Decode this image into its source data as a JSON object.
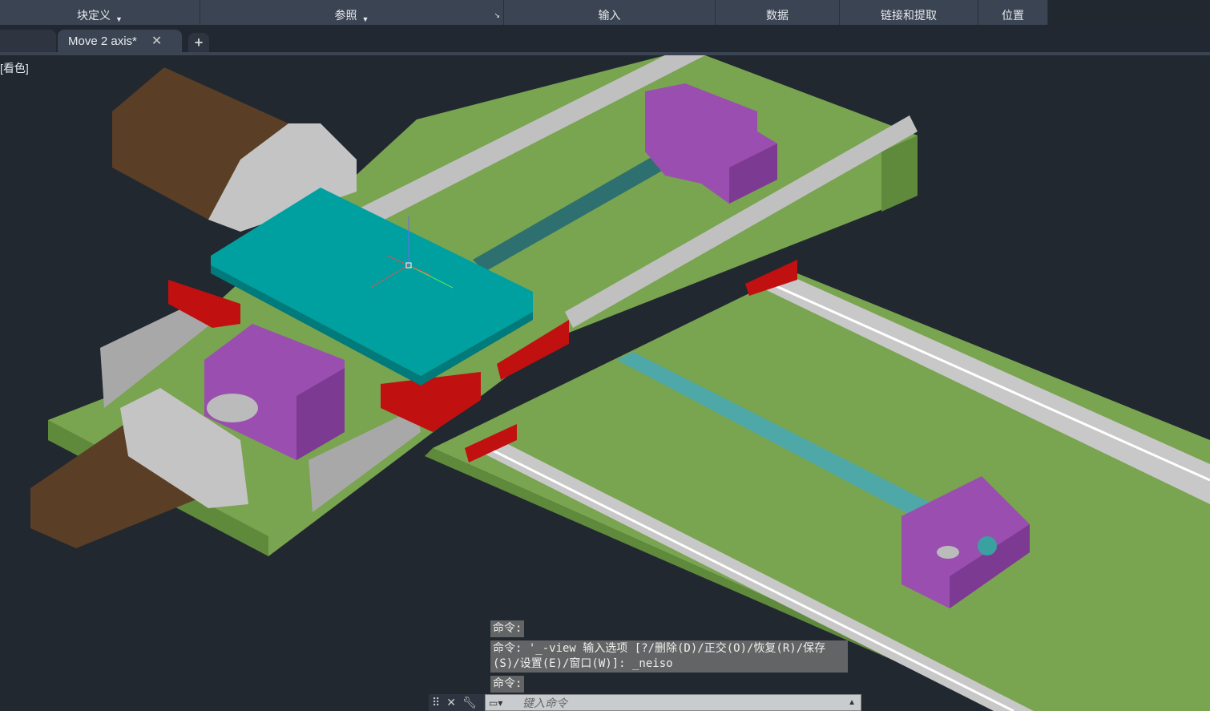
{
  "ribbon": {
    "panels": [
      {
        "label": "块定义",
        "dropdown": true
      },
      {
        "label": "参照",
        "dropdown": true
      },
      {
        "label": "输入"
      },
      {
        "label": "数据"
      },
      {
        "label": "链接和提取"
      },
      {
        "label": "位置"
      }
    ]
  },
  "tabs": {
    "active": "Move 2 axis*",
    "close": "✕",
    "new": "+"
  },
  "viewport": {
    "visual_style": "[看色]"
  },
  "command": {
    "history": [
      "命令:",
      "命令: '_-view 输入选项 [?/删除(D)/正交(O)/恢复(R)/保存(S)/设置(E)/窗口(W)]: _neiso",
      "命令:"
    ],
    "placeholder": "键入命令"
  },
  "colors": {
    "plate": "#79a450",
    "rail": "#b8b8b8",
    "block": "#9a4fb0",
    "carriage": "#c01010",
    "motor": "#5a3e26",
    "table": "#00a0a0",
    "shaft": "#2e7070"
  }
}
